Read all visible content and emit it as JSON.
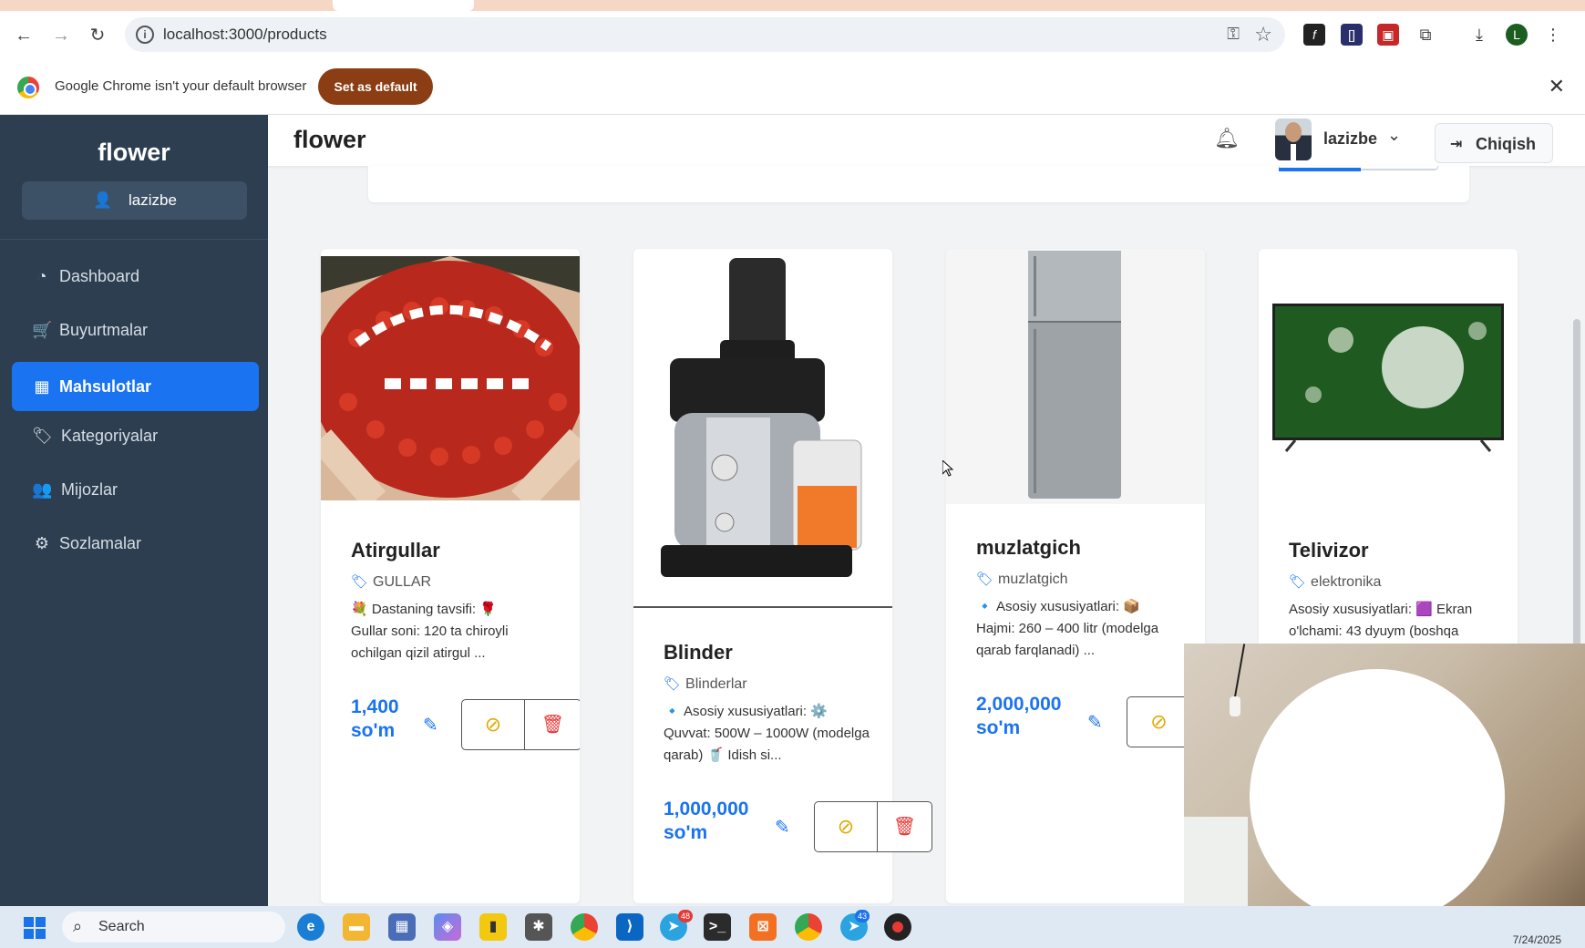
{
  "browser": {
    "url": "localhost:3000/products",
    "infobar": {
      "message": "Google Chrome isn't your default browser",
      "set_default_label": "Set as default"
    }
  },
  "sidebar": {
    "brand": "flower",
    "user": "lazizbe",
    "items": [
      {
        "label": "Dashboard",
        "icon": "gauge-icon"
      },
      {
        "label": "Buyurtmalar",
        "icon": "cart-icon"
      },
      {
        "label": "Mahsulotlar",
        "icon": "boxes-icon",
        "active": true
      },
      {
        "label": "Kategoriyalar",
        "icon": "tags-icon"
      },
      {
        "label": "Mijozlar",
        "icon": "users-icon"
      },
      {
        "label": "Sozlamalar",
        "icon": "gear-icon"
      }
    ]
  },
  "header": {
    "title": "flower",
    "username": "lazizbe",
    "logout_label": "Chiqish"
  },
  "products": [
    {
      "name": "Atirgullar",
      "category": "GULLAR",
      "desc_line1": "💐 Dastaning tavsifi: 🌹",
      "desc_line2": "Gullar soni: 120 ta chiroyli ochilgan qizil atirgul ...",
      "price": "1,400 so'm"
    },
    {
      "name": "Blinder",
      "category": "Blinderlar",
      "desc_line1": "🔹 Asosiy xususiyatlari: ⚙️",
      "desc_line2": "Quvvat: 500W – 1000W (modelga qarab) 🥤 Idish si...",
      "price": "1,000,000 so'm"
    },
    {
      "name": "muzlatgich",
      "category": "muzlatgich",
      "desc_line1": "🔹 Asosiy xususiyatlari: 📦",
      "desc_line2": "Hajmi: 260 – 400 litr (modelga qarab farqlanadi) ...",
      "price": "2,000,000 so'm"
    },
    {
      "name": "Telivizor",
      "category": "elektronika",
      "desc_line1": "Asosiy xususiyatlari: 🟪 Ekran",
      "desc_line2": "o'lchami: 43 dyuym (boshqa"
    }
  ],
  "taskbar": {
    "search_placeholder": "Search",
    "badges": [
      "48",
      "43"
    ],
    "clock_date": "7/24/2025"
  },
  "colors": {
    "sidebar_bg": "#2c3e50",
    "accent": "#1a73f0",
    "price": "#1a73f0",
    "delete": "#e53935",
    "hide": "#e0a800",
    "set_default_btn": "#8b3e13"
  }
}
